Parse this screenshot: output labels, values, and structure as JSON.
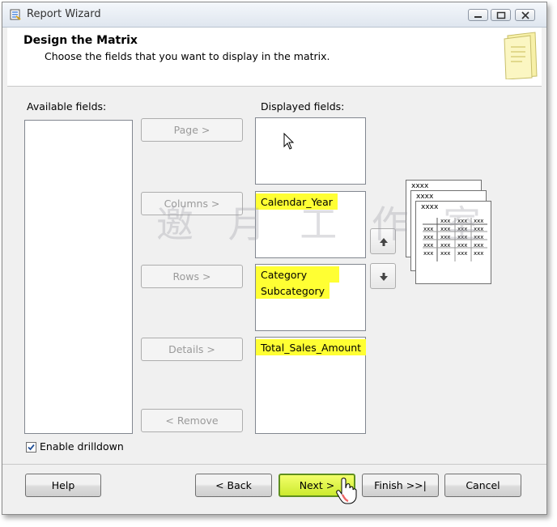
{
  "window": {
    "title": "Report Wizard"
  },
  "header": {
    "title": "Design the Matrix",
    "subtitle": "Choose the fields that you want to display in the matrix."
  },
  "available": {
    "label": "Available fields:"
  },
  "displayed": {
    "label": "Displayed fields:"
  },
  "move_buttons": {
    "page": "Page >",
    "columns": "Columns >",
    "rows": "Rows >",
    "details": "Details >",
    "remove": "< Remove"
  },
  "lists": {
    "columns": [
      "Calendar_Year"
    ],
    "rows": [
      "Category",
      "Subcategory"
    ],
    "details": [
      "Total_Sales_Amount"
    ]
  },
  "preview": {
    "xxxx": "xxxx",
    "cell": "xxx"
  },
  "watermark": "邀 月 工 作 室",
  "drilldown": {
    "label": "Enable drilldown",
    "checked": true
  },
  "footer": {
    "help": "Help",
    "back": "< Back",
    "next": "Next >",
    "finish": "Finish >>|",
    "cancel": "Cancel"
  }
}
